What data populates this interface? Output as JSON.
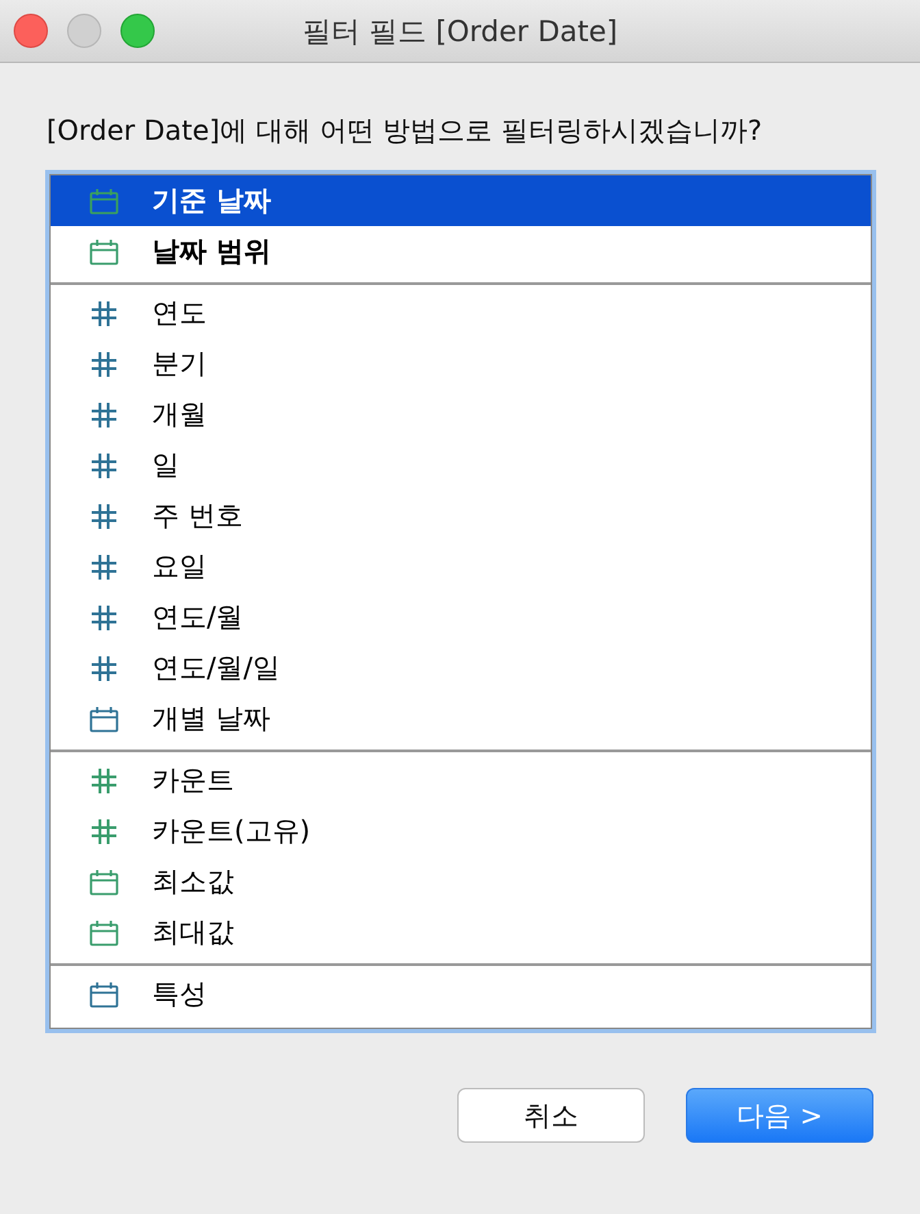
{
  "window": {
    "title": "필터 필드 [Order Date]"
  },
  "question": "[Order Date]에 대해 어떤 방법으로 필터링하시겠습니까?",
  "groups": [
    {
      "items": [
        {
          "label": "기준 날짜",
          "kind": "date",
          "color": "#3aa05e",
          "bold": true,
          "selected": true
        },
        {
          "label": "날짜 범위",
          "kind": "date",
          "color": "#3a9d6d",
          "bold": true,
          "selected": false
        }
      ]
    },
    {
      "items": [
        {
          "label": "연도",
          "kind": "number",
          "color": "#2f7396",
          "bold": false,
          "selected": false
        },
        {
          "label": "분기",
          "kind": "number",
          "color": "#2f7396",
          "bold": false,
          "selected": false
        },
        {
          "label": "개월",
          "kind": "number",
          "color": "#2f7396",
          "bold": false,
          "selected": false
        },
        {
          "label": "일",
          "kind": "number",
          "color": "#2f7396",
          "bold": false,
          "selected": false
        },
        {
          "label": "주 번호",
          "kind": "number",
          "color": "#2f7396",
          "bold": false,
          "selected": false
        },
        {
          "label": "요일",
          "kind": "number",
          "color": "#2f7396",
          "bold": false,
          "selected": false
        },
        {
          "label": "연도/월",
          "kind": "number",
          "color": "#2f7396",
          "bold": false,
          "selected": false
        },
        {
          "label": "연도/월/일",
          "kind": "number",
          "color": "#2f7396",
          "bold": false,
          "selected": false
        },
        {
          "label": "개별 날짜",
          "kind": "date",
          "color": "#2f7396",
          "bold": false,
          "selected": false
        }
      ]
    },
    {
      "items": [
        {
          "label": "카운트",
          "kind": "number",
          "color": "#3a9d6d",
          "bold": false,
          "selected": false
        },
        {
          "label": "카운트(고유)",
          "kind": "number",
          "color": "#3a9d6d",
          "bold": false,
          "selected": false
        },
        {
          "label": "최소값",
          "kind": "date",
          "color": "#3a9d6d",
          "bold": false,
          "selected": false
        },
        {
          "label": "최대값",
          "kind": "date",
          "color": "#3a9d6d",
          "bold": false,
          "selected": false
        }
      ]
    },
    {
      "items": [
        {
          "label": "특성",
          "kind": "date",
          "color": "#2f7396",
          "bold": false,
          "selected": false
        }
      ]
    }
  ],
  "buttons": [
    {
      "label": "취소",
      "kind": "default"
    },
    {
      "label": "다음 >",
      "kind": "primary"
    }
  ]
}
